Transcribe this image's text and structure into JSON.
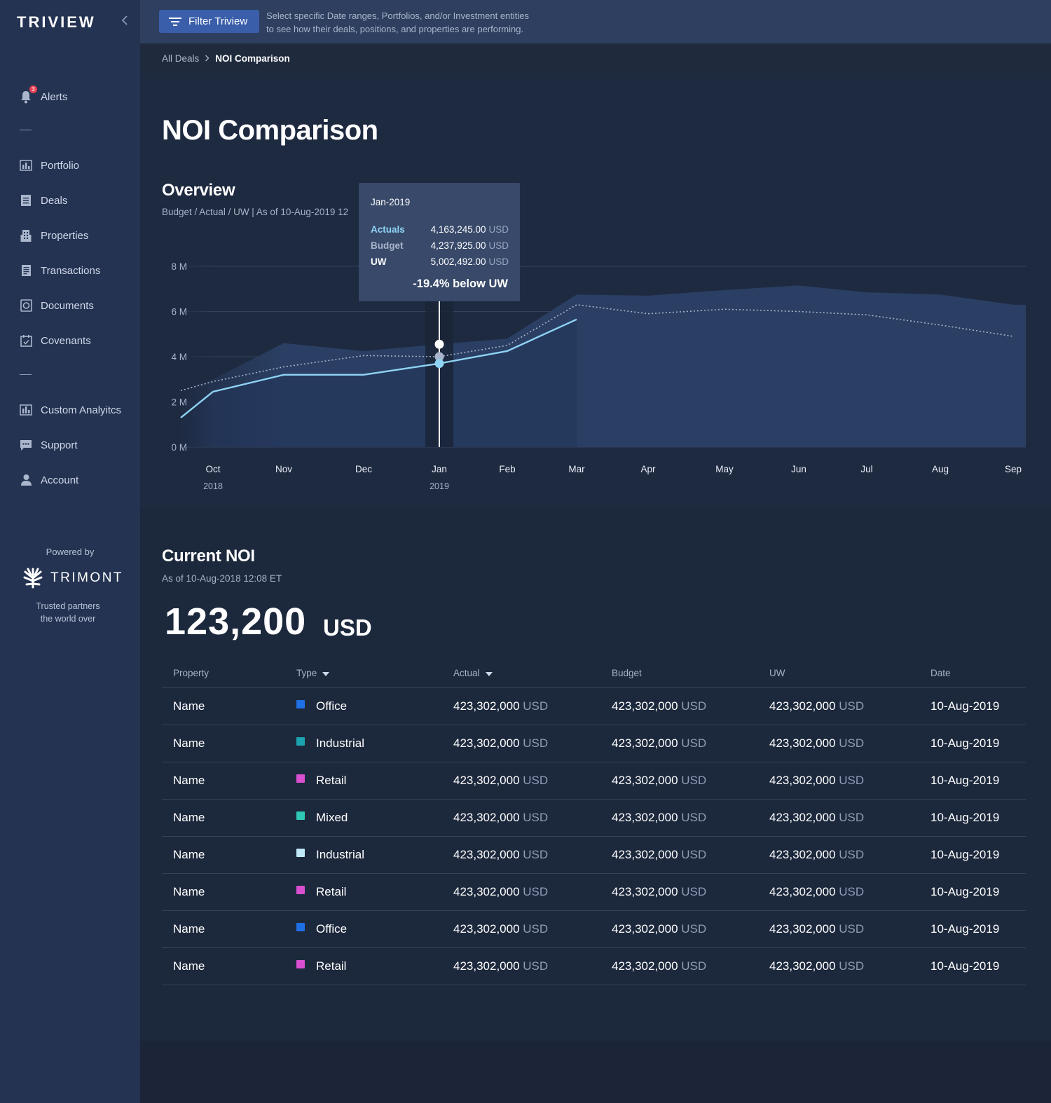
{
  "app": {
    "logo": "TRIVIEW"
  },
  "sidebar": {
    "alerts": {
      "label": "Alerts",
      "badge": "3"
    },
    "items": [
      {
        "label": "Portfolio",
        "icon": "bar-chart-icon"
      },
      {
        "label": "Deals",
        "icon": "document-icon"
      },
      {
        "label": "Properties",
        "icon": "building-icon"
      },
      {
        "label": "Transactions",
        "icon": "receipt-icon"
      },
      {
        "label": "Documents",
        "icon": "file-icon"
      },
      {
        "label": "Covenants",
        "icon": "calendar-check-icon"
      }
    ],
    "items2": [
      {
        "label": "Custom Analyitcs",
        "icon": "analytics-icon"
      },
      {
        "label": "Support",
        "icon": "chat-icon"
      },
      {
        "label": "Account",
        "icon": "user-icon"
      }
    ],
    "powered_by": "Powered by",
    "brand": "TRIMONT",
    "tagline_1": "Trusted partners",
    "tagline_2": "the world over"
  },
  "topbar": {
    "filter_label": "Filter Triview",
    "help_1": "Select specific Date ranges, Portfolios, and/or Investment entities",
    "help_2": "to see how their deals, positions, and properties are performing."
  },
  "breadcrumb": {
    "parent": "All Deals",
    "current": "NOI Comparison"
  },
  "page": {
    "title": "NOI Comparison"
  },
  "overview": {
    "title": "Overview",
    "subtitle": "Budget / Actual / UW | As of 10-Aug-2019 12"
  },
  "tooltip": {
    "date": "Jan-2019",
    "rows": [
      {
        "label": "Actuals",
        "value": "4,163,245.00",
        "currency": "USD",
        "color": "#8fd3f4"
      },
      {
        "label": "Budget",
        "value": "4,237,925.00",
        "currency": "USD",
        "color": "#a8b4c9"
      },
      {
        "label": "UW",
        "value": "5,002,492.00",
        "currency": "USD",
        "color": "#ffffff"
      }
    ],
    "diff": "-19.4% below UW"
  },
  "chart_data": {
    "type": "line",
    "x": [
      "Oct",
      "Nov",
      "Dec",
      "Jan",
      "Feb",
      "Mar",
      "Apr",
      "May",
      "Jun",
      "Jul",
      "Aug",
      "Sep"
    ],
    "x_year_labels": {
      "Oct": "2018",
      "Jan": "2019"
    },
    "yticks": [
      "0 M",
      "2 M",
      "4 M",
      "6 M",
      "8 M"
    ],
    "ylim": [
      0,
      8
    ],
    "highlight": "Jan",
    "series": [
      {
        "name": "UW",
        "style": "area",
        "values": [
          3.0,
          4.6,
          4.25,
          4.55,
          4.8,
          6.75,
          6.7,
          6.95,
          7.15,
          6.85,
          6.75,
          6.3
        ]
      },
      {
        "name": "Budget",
        "style": "dotted",
        "values": [
          2.9,
          3.55,
          4.05,
          4.0,
          4.5,
          6.3,
          5.9,
          6.1,
          6.0,
          5.85,
          5.4,
          4.9
        ]
      },
      {
        "name": "Actuals",
        "style": "solid",
        "values": [
          2.45,
          3.2,
          3.2,
          3.7,
          4.25,
          5.65
        ]
      }
    ]
  },
  "current_noi": {
    "title": "Current NOI",
    "subtitle": "As of 10-Aug-2018 12:08 ET",
    "value": "123,200",
    "currency": "USD"
  },
  "table": {
    "headers": {
      "property": "Property",
      "type": "Type",
      "actual": "Actual",
      "budget": "Budget",
      "uw": "UW",
      "date": "Date"
    },
    "rows": [
      {
        "property": "Name",
        "type": "Office",
        "color": "#1f6fe5",
        "actual": "423,302,000",
        "budget": "423,302,000",
        "uw": "423,302,000",
        "currency": "USD",
        "date": "10-Aug-2019"
      },
      {
        "property": "Name",
        "type": "Industrial",
        "color": "#1ba3b0",
        "actual": "423,302,000",
        "budget": "423,302,000",
        "uw": "423,302,000",
        "currency": "USD",
        "date": "10-Aug-2019"
      },
      {
        "property": "Name",
        "type": "Retail",
        "color": "#d94fd0",
        "actual": "423,302,000",
        "budget": "423,302,000",
        "uw": "423,302,000",
        "currency": "USD",
        "date": "10-Aug-2019"
      },
      {
        "property": "Name",
        "type": "Mixed",
        "color": "#2fc6b3",
        "actual": "423,302,000",
        "budget": "423,302,000",
        "uw": "423,302,000",
        "currency": "USD",
        "date": "10-Aug-2019"
      },
      {
        "property": "Name",
        "type": "Industrial",
        "color": "#bfe9f6",
        "actual": "423,302,000",
        "budget": "423,302,000",
        "uw": "423,302,000",
        "currency": "USD",
        "date": "10-Aug-2019"
      },
      {
        "property": "Name",
        "type": "Retail",
        "color": "#d94fd0",
        "actual": "423,302,000",
        "budget": "423,302,000",
        "uw": "423,302,000",
        "currency": "USD",
        "date": "10-Aug-2019"
      },
      {
        "property": "Name",
        "type": "Office",
        "color": "#1f6fe5",
        "actual": "423,302,000",
        "budget": "423,302,000",
        "uw": "423,302,000",
        "currency": "USD",
        "date": "10-Aug-2019"
      },
      {
        "property": "Name",
        "type": "Retail",
        "color": "#d94fd0",
        "actual": "423,302,000",
        "budget": "423,302,000",
        "uw": "423,302,000",
        "currency": "USD",
        "date": "10-Aug-2019"
      }
    ]
  }
}
